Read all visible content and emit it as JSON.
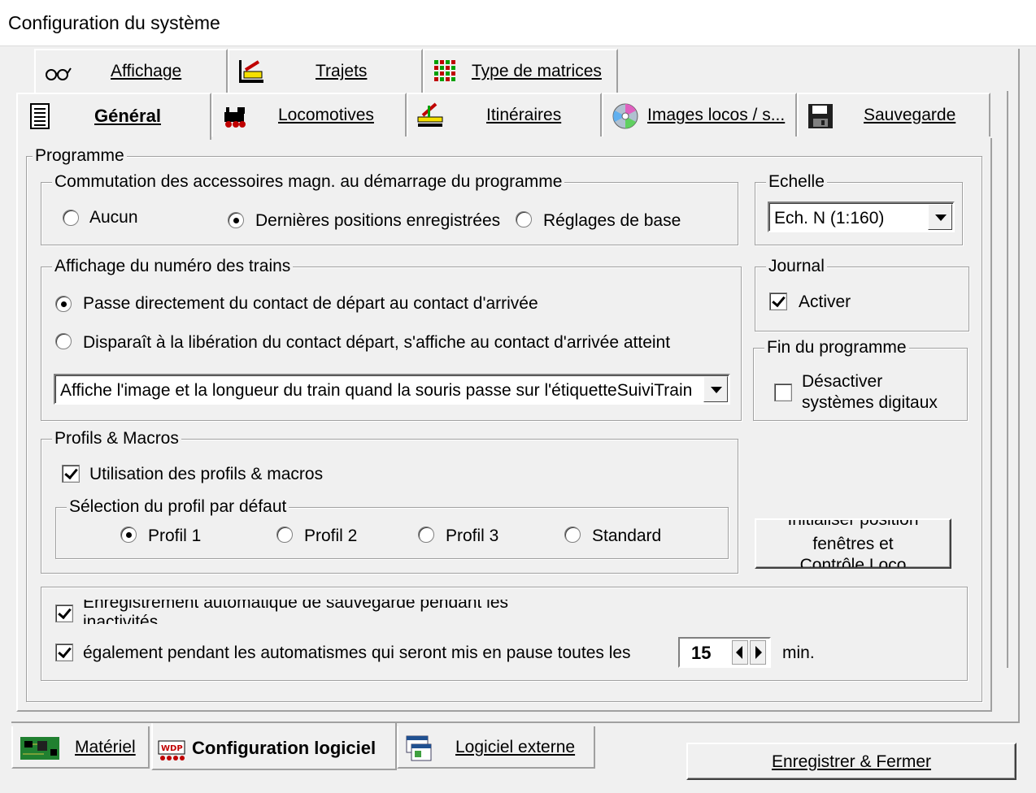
{
  "window": {
    "title": "Configuration du système"
  },
  "tabs_top": [
    {
      "label": "Affichage",
      "icon": "glasses-icon"
    },
    {
      "label": "Trajets",
      "icon": "track-icon"
    },
    {
      "label": "Type de matrices",
      "icon": "matrix-icon"
    }
  ],
  "tabs_second": [
    {
      "label": "Général",
      "icon": "notepad-icon",
      "active": true
    },
    {
      "label": "Locomotives",
      "icon": "locomotive-icon"
    },
    {
      "label": "Itinéraires",
      "icon": "signal-icon"
    },
    {
      "label": "Images locos / s...",
      "icon": "cd-icon"
    },
    {
      "label": "Sauvegarde",
      "icon": "floppy-icon"
    }
  ],
  "programme": {
    "legend": "Programme",
    "commutation": {
      "legend": "Commutation des accessoires magn. au démarrage du programme",
      "options": [
        "Aucun",
        "Dernières positions enregistrées",
        "Réglages de base"
      ],
      "selected": 1
    },
    "affichage_numero": {
      "legend": "Affichage du numéro des trains",
      "options": [
        "Passe directement du contact de départ au contact d'arrivée",
        "Disparaît à la libération du contact départ, s'affiche au contact d'arrivée atteint"
      ],
      "selected": 0,
      "combo_value": "Affiche l'image et la longueur du train quand la souris passe sur l'étiquetteSuiviTrain"
    },
    "profils": {
      "legend": "Profils & Macros",
      "use_label": "Utilisation des profils  & macros",
      "use_checked": true,
      "selection_legend": "Sélection du profil par défaut",
      "options": [
        "Profil 1",
        "Profil 2",
        "Profil 3",
        "Standard"
      ],
      "selected": 0
    },
    "echelle": {
      "legend": "Echelle",
      "value": "Ech. N  (1:160)"
    },
    "journal": {
      "legend": "Journal",
      "activer": "Activer",
      "checked": true
    },
    "fin": {
      "legend": "Fin du programme",
      "line1": "Désactiver",
      "line2": "systèmes digitaux",
      "checked": false
    },
    "init_button": {
      "line1": "Initialiser position",
      "line2": "fenêtres et",
      "line3": "Contrôle Loco"
    },
    "auto_save": {
      "line1": "Enregistrement automatique de sauvegarde pendant les",
      "line2": "inactivités",
      "checked": true,
      "also_label": "également pendant les automatismes qui seront mis en pause toutes les",
      "also_checked": true,
      "minutes": "15",
      "unit": "min."
    }
  },
  "bottom_tabs": [
    {
      "label": "Matériel",
      "icon": "circuit-board-icon"
    },
    {
      "label": "Configuration logiciel",
      "icon": "wdp-icon",
      "active": true
    },
    {
      "label": "Logiciel externe",
      "icon": "windows-icon"
    }
  ],
  "save_close": "Enregistrer & Fermer"
}
